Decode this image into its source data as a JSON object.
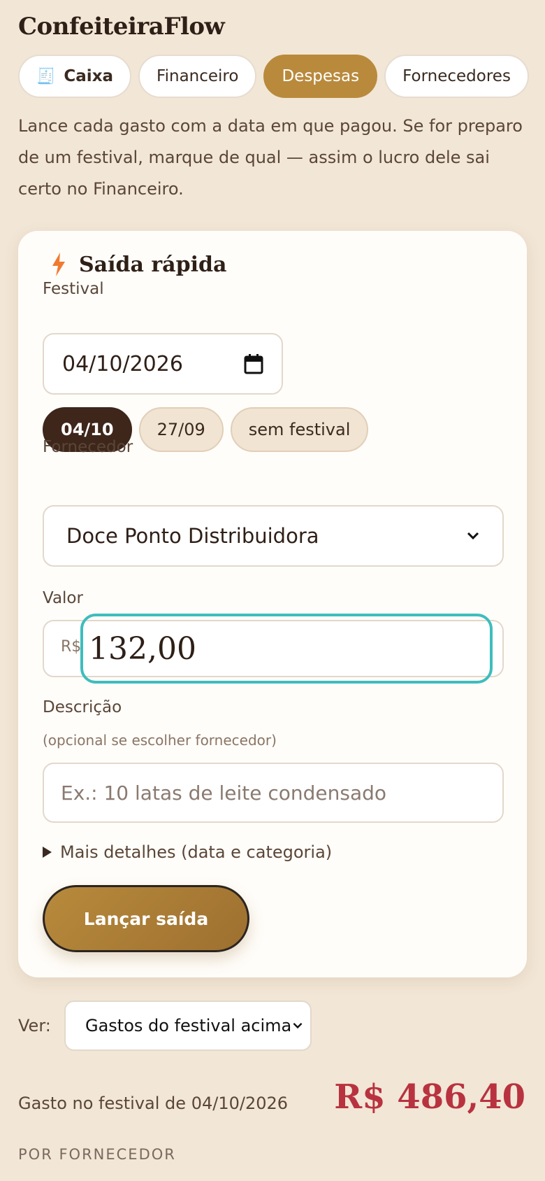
{
  "app": {
    "title": "ConfeiteiraFlow"
  },
  "tabs": [
    {
      "label": "Caixa",
      "icon": "receipt-icon",
      "active": false
    },
    {
      "label": "Financeiro",
      "active": false
    },
    {
      "label": "Despesas",
      "active": true
    },
    {
      "label": "Fornecedores",
      "active": false
    }
  ],
  "intro": "Lance cada gasto com a data em que pagou. Se for preparo de um festival, marque de qual — assim o lucro dele sai certo no Financeiro.",
  "card": {
    "title": "Saída rápida",
    "icon": "lightning-icon",
    "festival_label": "Festival",
    "festival_date": "04/10/2026",
    "festival_chips": [
      {
        "label": "04/10",
        "active": true
      },
      {
        "label": "27/09",
        "active": false
      },
      {
        "label": "sem festival",
        "active": false
      }
    ],
    "supplier_label": "Fornecedor",
    "supplier_value": "Doce Ponto Distribuidora",
    "value_label": "Valor",
    "currency": "R$",
    "value": "132,00",
    "description_label": "Descrição",
    "description_hint": "(opcional se escolher fornecedor)",
    "description_placeholder": "Ex.: 10 latas de leite condensado",
    "details_toggle": "Mais detalhes (data e categoria)",
    "submit_label": "Lançar saída"
  },
  "view": {
    "label": "Ver:",
    "selected": "Gastos do festival acima"
  },
  "summary": {
    "label": "Gasto no festival de 04/10/2026",
    "total": "R$ 486,40",
    "section_heading": "POR FORNECEDOR"
  },
  "colors": {
    "background": "#f2e6d6",
    "accent": "#b98a3c",
    "dark_chip": "#3e261b",
    "focus_ring": "#3ebdbd",
    "total": "#b8333f"
  }
}
